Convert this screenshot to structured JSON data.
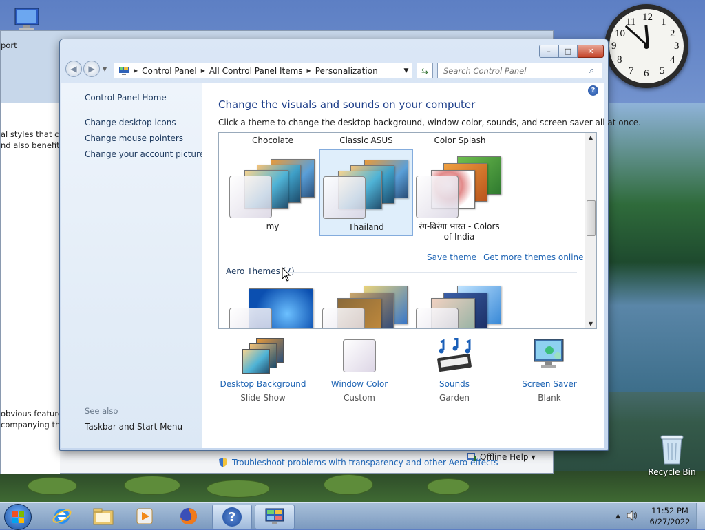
{
  "desktop": {
    "recycle_bin_label": "Recycle Bin"
  },
  "background_window": {
    "title_fragment": "port",
    "text_lines": [
      "al styles that cor",
      "nd also benefit fr",
      "obvious features",
      "companying the"
    ],
    "offline_help_label": "Offline Help"
  },
  "clock_gadget": {
    "numbers": [
      "12",
      "1",
      "2",
      "3",
      "4",
      "5",
      "6",
      "7",
      "8",
      "9",
      "10",
      "11"
    ]
  },
  "window": {
    "controls": {
      "minimize": "–",
      "maximize": "□",
      "close": "✕"
    },
    "breadcrumb": [
      "Control Panel",
      "All Control Panel Items",
      "Personalization"
    ],
    "search_placeholder": "Search Control Panel"
  },
  "left_pane": {
    "home_link": "Control Panel Home",
    "links": [
      "Change desktop icons",
      "Change mouse pointers",
      "Change your account picture"
    ],
    "see_also_label": "See also",
    "see_also_links": [
      "Taskbar and Start Menu"
    ]
  },
  "content": {
    "title": "Change the visuals and sounds on your computer",
    "subtitle": "Click a theme to change the desktop background, window color, sounds, and screen saver all at once.",
    "column_headers": [
      "Chocolate",
      "Classic ASUS",
      "Color Splash"
    ],
    "themes": [
      {
        "name": "my",
        "selected": false
      },
      {
        "name": "Thailand",
        "selected": true
      },
      {
        "name": "रंग-बिरंगा भारत - Colors of India",
        "selected": false
      }
    ],
    "save_theme_link": "Save theme",
    "get_more_link": "Get more themes online",
    "aero_header": "Aero Themes (7)",
    "bottom_items": [
      {
        "label": "Desktop Background",
        "sub": "Slide Show",
        "icon": "desktop-background-icon"
      },
      {
        "label": "Window Color",
        "sub": "Custom",
        "icon": "window-color-icon"
      },
      {
        "label": "Sounds",
        "sub": "Garden",
        "icon": "sounds-icon"
      },
      {
        "label": "Screen Saver",
        "sub": "Blank",
        "icon": "screen-saver-icon"
      }
    ],
    "troubleshoot_link": "Troubleshoot problems with transparency and other Aero effects"
  },
  "taskbar": {
    "time": "11:52 PM",
    "date": "6/27/2022",
    "help_glyph": "?"
  }
}
